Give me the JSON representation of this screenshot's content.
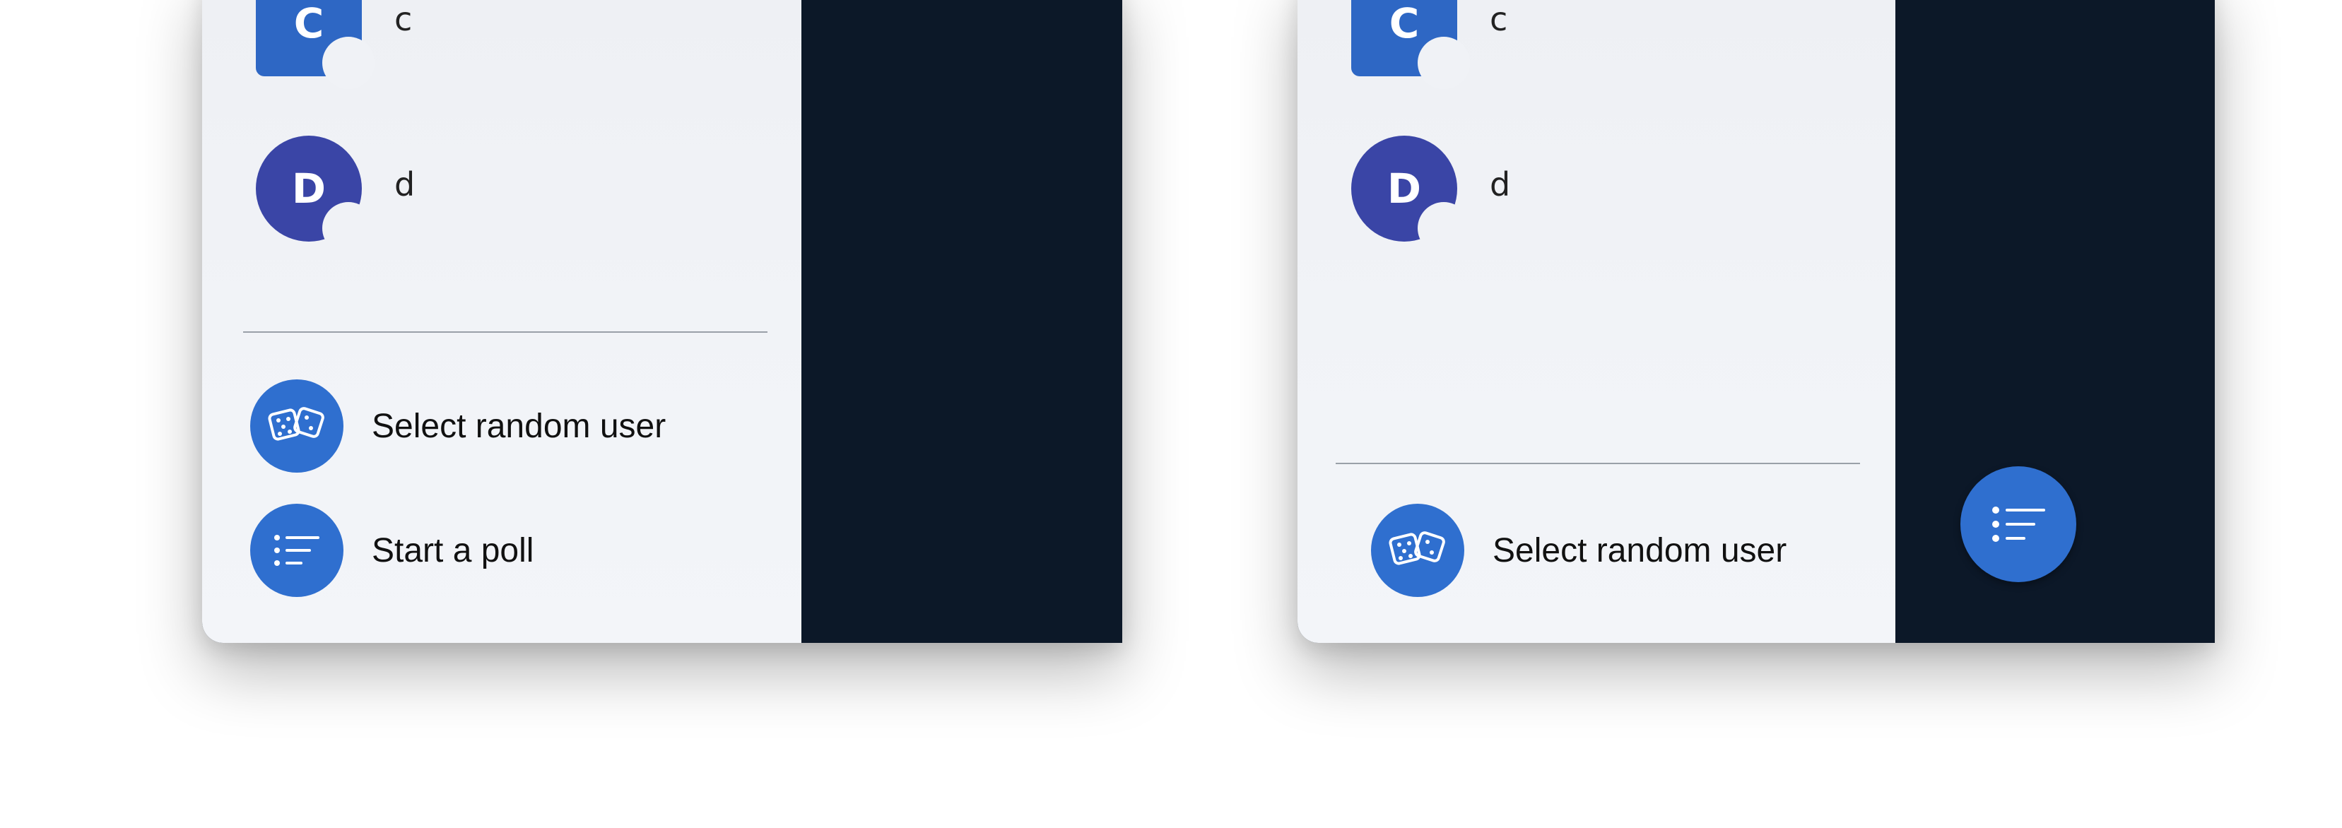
{
  "colors": {
    "sidebar_bg": "#f0f2f6",
    "dark_bg": "#0c1828",
    "accent_blue": "#2f6fcf",
    "avatar_c": "#2e67c4",
    "avatar_d": "#3a45a6"
  },
  "left_panel": {
    "participants": [
      {
        "initial": "C",
        "name": "c"
      },
      {
        "initial": "D",
        "name": "d"
      }
    ],
    "actions": [
      {
        "icon": "dice-icon",
        "label": "Select random user"
      },
      {
        "icon": "poll-list-icon",
        "label": "Start a poll"
      }
    ]
  },
  "right_panel": {
    "participants": [
      {
        "initial": "C",
        "name": "c"
      },
      {
        "initial": "D",
        "name": "d"
      }
    ],
    "actions": [
      {
        "icon": "dice-icon",
        "label": "Select random user"
      }
    ],
    "fab": {
      "icon": "poll-list-icon"
    }
  }
}
